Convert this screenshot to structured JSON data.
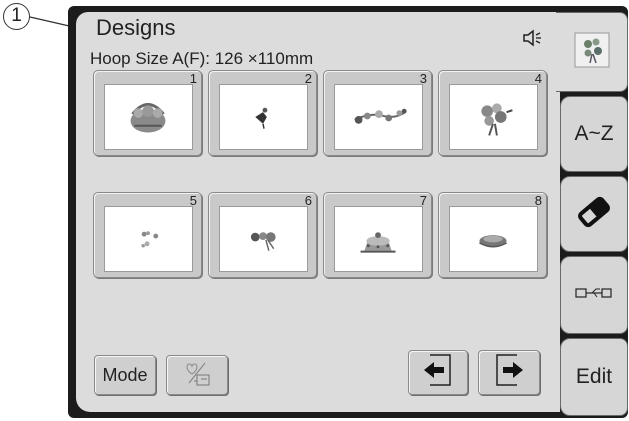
{
  "callout": {
    "label": "1"
  },
  "header": {
    "title": "Designs",
    "hoop_size": "Hoop Size  A(F): 126 ×110mm",
    "sound_icon": "speaker-icon"
  },
  "designs": [
    {
      "number": "1",
      "motif": "flower-basket"
    },
    {
      "number": "2",
      "motif": "small-bird"
    },
    {
      "number": "3",
      "motif": "floral-spray"
    },
    {
      "number": "4",
      "motif": "flower-bouquet"
    },
    {
      "number": "5",
      "motif": "scattered-flowers"
    },
    {
      "number": "6",
      "motif": "flower-ribbon"
    },
    {
      "number": "7",
      "motif": "cake"
    },
    {
      "number": "8",
      "motif": "plate"
    }
  ],
  "side_tabs": [
    {
      "id": "designs",
      "icon": "flower-icon",
      "active": true
    },
    {
      "id": "fonts",
      "label": "A~Z"
    },
    {
      "id": "memory",
      "icon": "eraser-icon"
    },
    {
      "id": "usb",
      "icon": "usb-icon"
    },
    {
      "id": "edit",
      "label": "Edit"
    }
  ],
  "footer": {
    "mode_label": "Mode",
    "heart_machine_icon": "heart-machine-icon",
    "prev_icon": "arrow-left-icon",
    "next_icon": "arrow-right-icon"
  },
  "colors": {
    "frame": "#1c1c1c",
    "screen": "#dcdcdc",
    "tile": "#c9c9c9"
  }
}
